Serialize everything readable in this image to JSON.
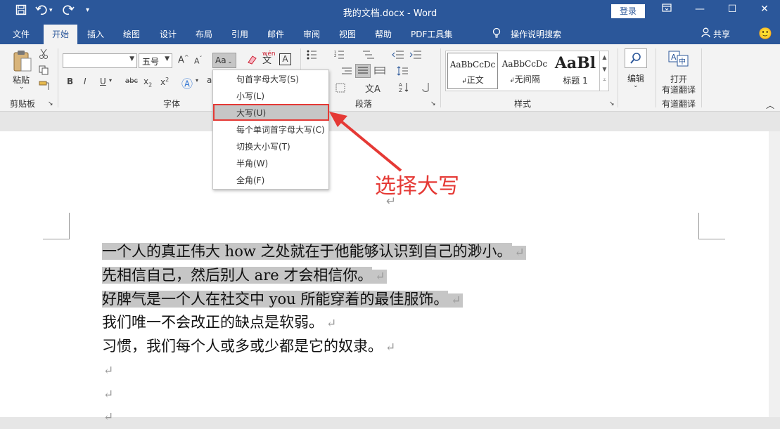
{
  "window": {
    "title": "我的文档.docx - Word",
    "login_label": "登录"
  },
  "quick_access": {
    "save_icon": "save-icon",
    "undo_icon": "undo-icon",
    "redo_icon": "redo-icon",
    "customize_icon": "customize-icon"
  },
  "tabs": [
    "文件",
    "开始",
    "插入",
    "绘图",
    "设计",
    "布局",
    "引用",
    "邮件",
    "审阅",
    "视图",
    "帮助",
    "PDF工具集"
  ],
  "active_tab": "开始",
  "tell_me": "操作说明搜索",
  "share": "共享",
  "ribbon": {
    "clipboard": {
      "paste": "粘贴",
      "label": "剪贴板"
    },
    "font": {
      "font_name": "",
      "font_size": "五号",
      "case_button": "Aa",
      "label": "字体"
    },
    "paragraph": {
      "label": "段落"
    },
    "styles": {
      "label": "样式",
      "items": [
        {
          "sample": "AaBbCcDc",
          "name": "正文"
        },
        {
          "sample": "AaBbCcDc",
          "name": "无间隔"
        },
        {
          "sample": "AaBl",
          "name": "标题 1"
        }
      ]
    },
    "editing": {
      "label": "编辑"
    },
    "youdao": {
      "open": "打开",
      "translate": "有道翻译",
      "label": "有道翻译"
    }
  },
  "dropdown": {
    "items": [
      "句首字母大写(S)",
      "小写(L)",
      "大写(U)",
      "每个单词首字母大写(C)",
      "切换大小写(T)",
      "半角(W)",
      "全角(F)"
    ],
    "highlighted_index": 2
  },
  "annotation": "选择大写",
  "document": {
    "lines": [
      {
        "text": "一个人的真正伟大 how 之处就在于他能够认识到自己的渺小。",
        "selected": true
      },
      {
        "text": "先相信自己，然后别人 are 才会相信你。",
        "selected": true
      },
      {
        "text": "好脾气是一个人在社交中 you 所能穿着的最佳服饰。",
        "selected": true
      },
      {
        "text": "我们唯一不会改正的缺点是软弱。",
        "selected": false
      },
      {
        "text": "习惯，我们每个人或多或少都是它的奴隶。",
        "selected": false
      }
    ],
    "paragraph_mark": "↵"
  },
  "colors": {
    "title_bar": "#2b579a",
    "ribbon": "#f3f3f3",
    "annotation": "#e53935",
    "selection": "#c6c6c6"
  }
}
